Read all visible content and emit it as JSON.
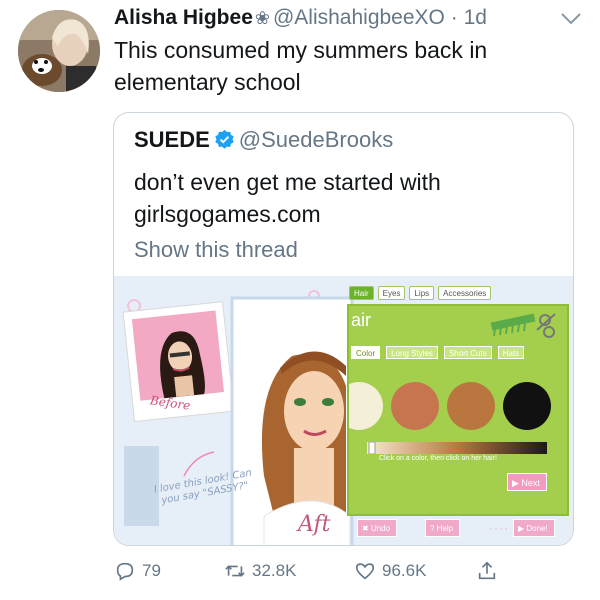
{
  "tweet": {
    "author_name": "Alisha Higbee",
    "name_emoji": "❀",
    "handle": "@AlishahigbeeXO",
    "separator": "·",
    "time": "1d",
    "text": "This consumed my summers back in elementary school"
  },
  "quoted": {
    "author_name": "SUEDE",
    "handle": "@SuedeBrooks",
    "text": "don’t even get me started with girlsgogames.com",
    "show_thread": "Show this thread",
    "image": {
      "before_label": "Before",
      "caption": "I love this look! Can you say \"SASSY?\"",
      "after_label": "Aft",
      "tabs": [
        "Hair",
        "Eyes",
        "Lips",
        "Accessories"
      ],
      "panel_title": "air",
      "subtabs": [
        "Color",
        "Long Styles",
        "Short Cuts",
        "Hats"
      ],
      "hint": "Click on a color, then click on her hair!",
      "next": "Next",
      "undo": "Undo",
      "help": "Help",
      "dots": "····",
      "done": "Done!"
    }
  },
  "actions": {
    "replies": "79",
    "retweets": "32.8K",
    "likes": "96.6K"
  },
  "colors": {
    "text": "#14171a",
    "secondary": "#657786",
    "verified": "#1da1f2",
    "border": "#ccd6dd",
    "game_green": "#a4cf4d"
  },
  "icons": [
    "chevron-down-icon",
    "verified-badge-icon",
    "reply-icon",
    "retweet-icon",
    "like-icon",
    "share-icon"
  ]
}
